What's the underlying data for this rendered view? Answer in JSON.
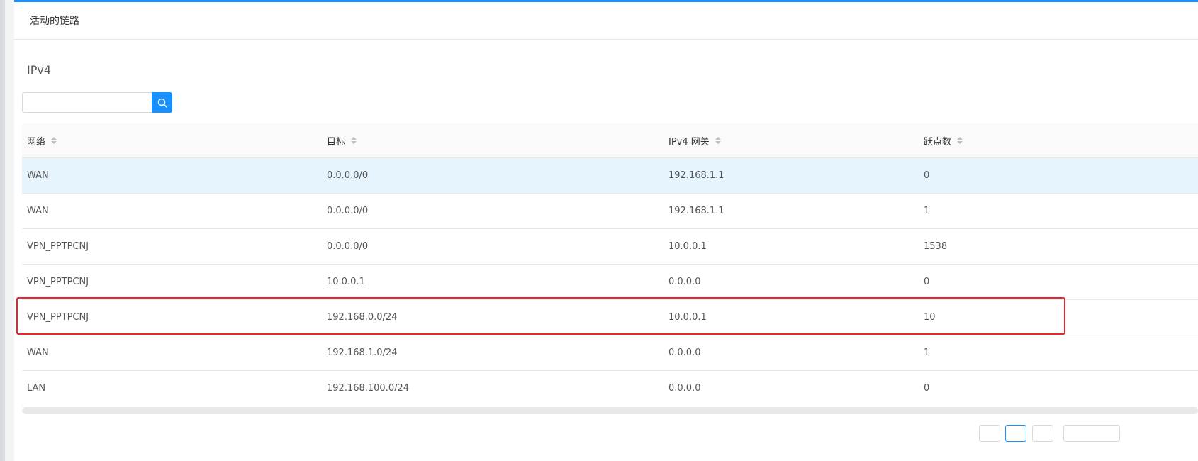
{
  "card": {
    "title": "活动的链路"
  },
  "section": {
    "title": "IPv4"
  },
  "search": {
    "value": "",
    "placeholder": ""
  },
  "table": {
    "columns": [
      "网络",
      "目标",
      "IPv4 网关",
      "跃点数"
    ],
    "rows": [
      {
        "network": "WAN",
        "target": "0.0.0.0/0",
        "gateway": "192.168.1.1",
        "metric": "0"
      },
      {
        "network": "WAN",
        "target": "0.0.0.0/0",
        "gateway": "192.168.1.1",
        "metric": "1"
      },
      {
        "network": "VPN_PPTPCNJ",
        "target": "0.0.0.0/0",
        "gateway": "10.0.0.1",
        "metric": "1538"
      },
      {
        "network": "VPN_PPTPCNJ",
        "target": "10.0.0.1",
        "gateway": "0.0.0.0",
        "metric": "0"
      },
      {
        "network": "VPN_PPTPCNJ",
        "target": "192.168.0.0/24",
        "gateway": "10.0.0.1",
        "metric": "10"
      },
      {
        "network": "WAN",
        "target": "192.168.1.0/24",
        "gateway": "0.0.0.0",
        "metric": "1"
      },
      {
        "network": "LAN",
        "target": "192.168.100.0/24",
        "gateway": "0.0.0.0",
        "metric": "0"
      }
    ]
  },
  "colors": {
    "accent": "#1890ff",
    "highlight": "#e8262d",
    "selected_row": "#e6f4fd"
  },
  "icons": {
    "search": "search-icon",
    "sort": "sort-icon"
  }
}
